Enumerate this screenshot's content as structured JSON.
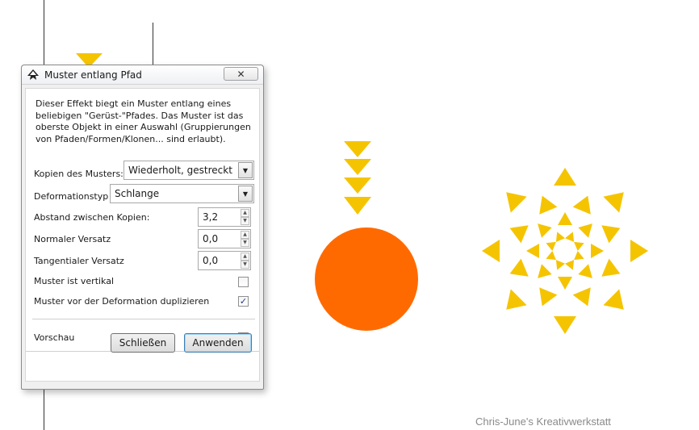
{
  "dialog": {
    "title": "Muster entlang Pfad",
    "description": "Dieser Effekt biegt ein Muster entlang eines beliebigen \"Gerüst-\"Pfades. Das Muster ist das oberste Objekt in einer Auswahl (Gruppierungen von Pfaden/Formen/Klonen... sind erlaubt).",
    "copies_label": "Kopien des Musters:",
    "copies_value": "Wiederholt, gestreckt",
    "deformation_label": "Deformationstyp",
    "deformation_value": "Schlange",
    "spacing_label": "Abstand zwischen Kopien:",
    "spacing_value": "3,2",
    "normal_offset_label": "Normaler Versatz",
    "normal_offset_value": "0,0",
    "tangential_offset_label": "Tangentialer Versatz",
    "tangential_offset_value": "0,0",
    "vertical_label": "Muster ist vertikal",
    "vertical_checked": false,
    "duplicate_label": "Muster vor der Deformation duplizieren",
    "duplicate_checked": true,
    "preview_label": "Vorschau",
    "preview_checked": false,
    "close_button": "Schließen",
    "apply_button": "Anwenden",
    "close_glyph": "✕",
    "check_glyph": "✓",
    "arrow_glyph": "▼",
    "spin_up_glyph": "▲",
    "spin_down_glyph": "▼"
  },
  "canvas": {
    "pattern_color": "#F5C400",
    "circle_color": "#FF6A00",
    "watermark": "Chris-June's Kreativwerkstatt"
  },
  "icons": [
    "inkscape-icon",
    "close-icon",
    "dropdown-arrow-icon",
    "checkmark-icon"
  ]
}
